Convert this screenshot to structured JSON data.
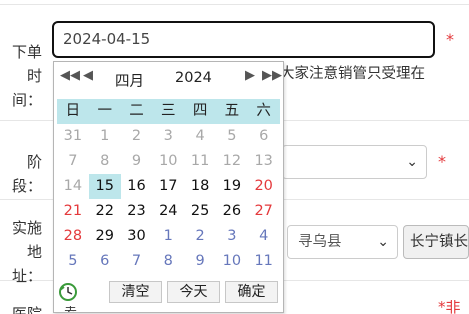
{
  "form": {
    "order_time_label_line1": "下单时",
    "order_time_label_line2": "间：",
    "order_time_value": "2024-04-15",
    "required_mark": "*",
    "notice_text": "大家注意销管只受理在",
    "stage_label": "阶段：",
    "stage_required_mark": "*",
    "impl_label_line1": "实施地",
    "impl_label_line2": "址：",
    "county_select": "寻乌县",
    "town_button": "长宁镇长",
    "bottom_label": "医院加",
    "bottom_required": "*非"
  },
  "datepicker": {
    "month": "四月",
    "year": "2024",
    "weekdays": [
      "日",
      "一",
      "二",
      "三",
      "四",
      "五",
      "六"
    ],
    "weeks": [
      [
        {
          "d": "31",
          "t": "other"
        },
        {
          "d": "1",
          "t": "other"
        },
        {
          "d": "2",
          "t": "other"
        },
        {
          "d": "3",
          "t": "other"
        },
        {
          "d": "4",
          "t": "other"
        },
        {
          "d": "5",
          "t": "other"
        },
        {
          "d": "6",
          "t": "other"
        }
      ],
      [
        {
          "d": "7",
          "t": "other"
        },
        {
          "d": "8",
          "t": "other"
        },
        {
          "d": "9",
          "t": "other"
        },
        {
          "d": "10",
          "t": "other"
        },
        {
          "d": "11",
          "t": "other"
        },
        {
          "d": "12",
          "t": "other"
        },
        {
          "d": "13",
          "t": "other"
        }
      ],
      [
        {
          "d": "14",
          "t": "other"
        },
        {
          "d": "15",
          "t": "today"
        },
        {
          "d": "16",
          "t": "cur"
        },
        {
          "d": "17",
          "t": "cur"
        },
        {
          "d": "18",
          "t": "cur"
        },
        {
          "d": "19",
          "t": "cur"
        },
        {
          "d": "20",
          "t": "wkend"
        }
      ],
      [
        {
          "d": "21",
          "t": "wkend"
        },
        {
          "d": "22",
          "t": "cur"
        },
        {
          "d": "23",
          "t": "cur"
        },
        {
          "d": "24",
          "t": "cur"
        },
        {
          "d": "25",
          "t": "cur"
        },
        {
          "d": "26",
          "t": "cur"
        },
        {
          "d": "27",
          "t": "wkend"
        }
      ],
      [
        {
          "d": "28",
          "t": "wkend"
        },
        {
          "d": "29",
          "t": "cur"
        },
        {
          "d": "30",
          "t": "cur"
        },
        {
          "d": "1",
          "t": "next"
        },
        {
          "d": "2",
          "t": "next"
        },
        {
          "d": "3",
          "t": "next"
        },
        {
          "d": "4",
          "t": "next"
        }
      ],
      [
        {
          "d": "5",
          "t": "next"
        },
        {
          "d": "6",
          "t": "next"
        },
        {
          "d": "7",
          "t": "next"
        },
        {
          "d": "8",
          "t": "next"
        },
        {
          "d": "9",
          "t": "next"
        },
        {
          "d": "10",
          "t": "next"
        },
        {
          "d": "11",
          "t": "next"
        }
      ]
    ],
    "clear_label": "清空",
    "today_label": "今天",
    "ok_label": "确定",
    "bottom_peek": "丟"
  },
  "colors": {
    "accent": "#bde6eb",
    "weekend": "#e4393c",
    "next_month": "#6677bb",
    "other_month": "#a8a8a8"
  }
}
